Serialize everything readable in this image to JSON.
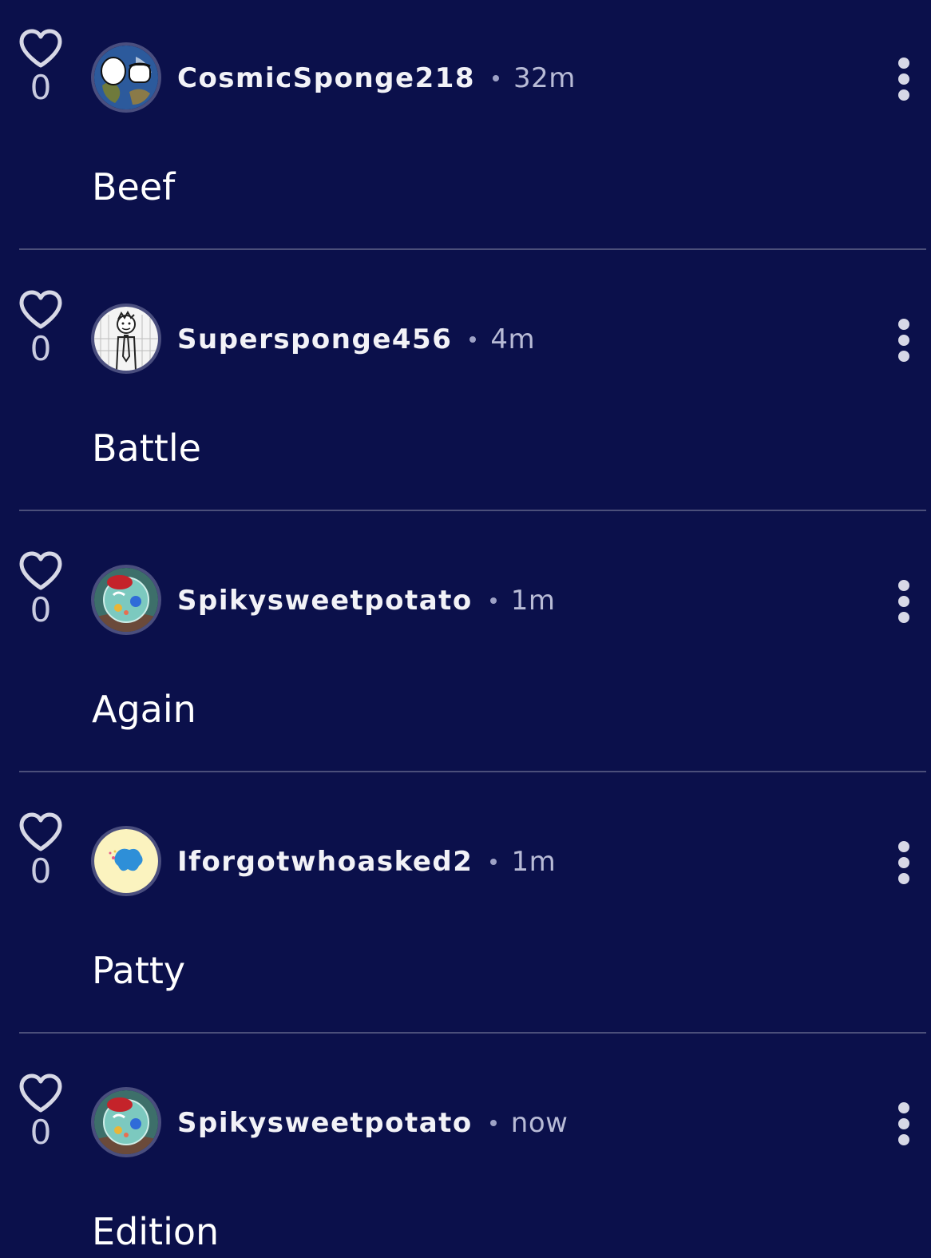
{
  "comments": [
    {
      "likes": "0",
      "username": "CosmicSponge218",
      "time": "32m",
      "text": "Beef",
      "avatar": "earth-eyes-avatar"
    },
    {
      "likes": "0",
      "username": "Supersponge456",
      "time": "4m",
      "text": "Battle",
      "avatar": "sketch-man-avatar"
    },
    {
      "likes": "0",
      "username": "Spikysweetpotato",
      "time": "1m",
      "text": "Again",
      "avatar": "teal-bubble-avatar"
    },
    {
      "likes": "0",
      "username": "Iforgotwhoasked2",
      "time": "1m",
      "text": "Patty",
      "avatar": "blue-blob-avatar"
    },
    {
      "likes": "0",
      "username": "Spikysweetpotato",
      "time": "now",
      "text": "Edition",
      "avatar": "teal-bubble-avatar"
    }
  ],
  "icons": {
    "like": "heart-outline-icon",
    "menu": "more-vertical-icon"
  },
  "colors": {
    "background": "#0b104b",
    "divider": "#4b4f7a",
    "text": "#ffffff",
    "muted": "#b8bbd6"
  }
}
